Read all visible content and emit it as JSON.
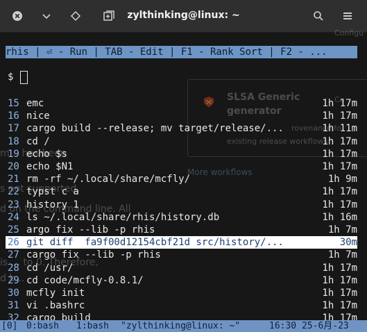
{
  "window": {
    "title": "zylthinking@linux: ~"
  },
  "header_bar": {
    "text": "rhis | ⏎ - Run | TAB - Edit | F1 - Rank Sort | F2 - ..."
  },
  "prompt": {
    "symbol": "$"
  },
  "history": [
    {
      "num": "15",
      "cmd": "emc",
      "time": "1h 17m"
    },
    {
      "num": "16",
      "cmd": "nice",
      "time": "1h 17m"
    },
    {
      "num": "17",
      "cmd": "cargo build --release; mv target/release/...",
      "time": "1h 11m"
    },
    {
      "num": "18",
      "cmd": "cd /",
      "time": "1h 17m"
    },
    {
      "num": "19",
      "cmd": "echo $s",
      "time": "1h 17m"
    },
    {
      "num": "20",
      "cmd": "echo $N1",
      "time": "1h 17m"
    },
    {
      "num": "21",
      "cmd": "rm -rf ~/.local/share/mcfly/",
      "time": "1h 9m"
    },
    {
      "num": "22",
      "cmd": "typst c a",
      "time": "1h 17m"
    },
    {
      "num": "23",
      "cmd": "history 1",
      "time": "1h 17m"
    },
    {
      "num": "24",
      "cmd": "ls ~/.local/share/rhis/history.db",
      "time": "1h 16m"
    },
    {
      "num": "25",
      "cmd": "argo fix --lib -p rhis",
      "time": "1h 7m"
    },
    {
      "num": "26",
      "cmd": "git diff  fa9f00d12154cbf21d src/history/...",
      "time": "30m",
      "selected": true
    },
    {
      "num": "27",
      "cmd": "cargo fix --lib -p rhis",
      "time": "1h 7m"
    },
    {
      "num": "28",
      "cmd": "cd /usr/",
      "time": "1h 17m"
    },
    {
      "num": "29",
      "cmd": "cd code/mcfly-0.8.1/",
      "time": "1h 17m"
    },
    {
      "num": "30",
      "cmd": "mcfly init",
      "time": "1h 17m"
    },
    {
      "num": "31",
      "cmd": "vi .bashrc",
      "time": "1h 17m"
    },
    {
      "num": "32",
      "cmd": "cargo build",
      "time": "1h 17m"
    }
  ],
  "tmux": {
    "session": "[0]",
    "window0": "0:bash",
    "window1": "1:bash",
    "host": "\"zylthinking@linux: ~\"",
    "clock": "16:30 25-6月-23"
  },
  "background_text": {
    "card1_title": "SLSA Generic",
    "card1_title2": "generator",
    "card1_desc1": "rovenance fo",
    "card1_desc2": "existing release workflows",
    "more_workflows": "More workflows",
    "configure1": "Configu",
    "configure2": "Co",
    "left1": "m... has been",
    "left2": "s not supported.",
    "left3": "d on the command line. All",
    "left4": "is ... to 0. Therefore,",
    "left5": "d b..."
  },
  "colors": {
    "accent": "#6d96c6",
    "line_number": "#8fb5e8",
    "selected_bg": "#ffffff",
    "status_bg": "#6f93c4"
  },
  "icons": [
    "close-icon",
    "chevron-down-icon",
    "pin-icon",
    "new-tab-icon",
    "search-icon",
    "hamburger-menu-icon"
  ]
}
